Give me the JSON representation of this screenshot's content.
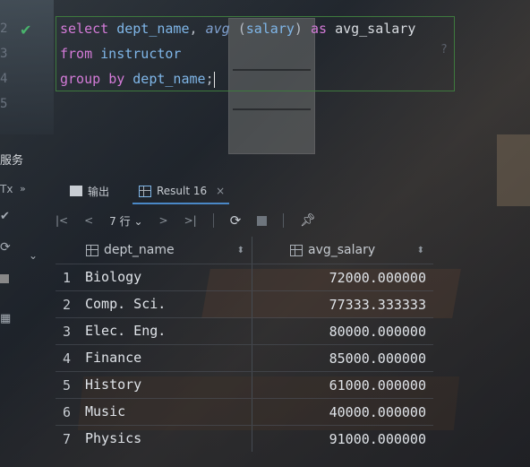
{
  "editor": {
    "line_numbers": [
      "2",
      "3",
      "4",
      "5"
    ],
    "lines": {
      "l1": {
        "kw1": "select",
        "id1": "dept_name",
        "comma": ",",
        "fn": "avg",
        "paren_open": "(",
        "arg": "salary",
        "paren_close": ")",
        "kw2": "as",
        "alias": "avg_salary"
      },
      "l2": {
        "kw": "from",
        "id": "instructor"
      },
      "l3": {
        "kw1": "group",
        "kw2": "by",
        "id": "dept_name",
        "semi": ";"
      }
    },
    "ghost_text": "?"
  },
  "services": {
    "title": "服务",
    "rail_text": "Tx",
    "tabs": [
      {
        "label": "输出",
        "icon": "console-output-icon"
      },
      {
        "label": "Result 16",
        "icon": "table-grid-icon",
        "closable": true
      }
    ],
    "close_glyph": "×",
    "grid_toolbar": {
      "rows_label": "7 行",
      "rows_dropdown": "⌄"
    }
  },
  "result": {
    "columns": [
      "dept_name",
      "avg_salary"
    ],
    "rows": [
      {
        "n": "1",
        "dept_name": "Biology",
        "avg_salary": "72000.000000"
      },
      {
        "n": "2",
        "dept_name": "Comp. Sci.",
        "avg_salary": "77333.333333"
      },
      {
        "n": "3",
        "dept_name": "Elec. Eng.",
        "avg_salary": "80000.000000"
      },
      {
        "n": "4",
        "dept_name": "Finance",
        "avg_salary": "85000.000000"
      },
      {
        "n": "5",
        "dept_name": "History",
        "avg_salary": "61000.000000"
      },
      {
        "n": "6",
        "dept_name": "Music",
        "avg_salary": "40000.000000"
      },
      {
        "n": "7",
        "dept_name": "Physics",
        "avg_salary": "91000.000000"
      }
    ]
  },
  "colors": {
    "keyword": "#d47bd8",
    "identifier": "#7fb6e8",
    "success_check": "#49b36c",
    "tab_underline": "#4a88c7"
  }
}
